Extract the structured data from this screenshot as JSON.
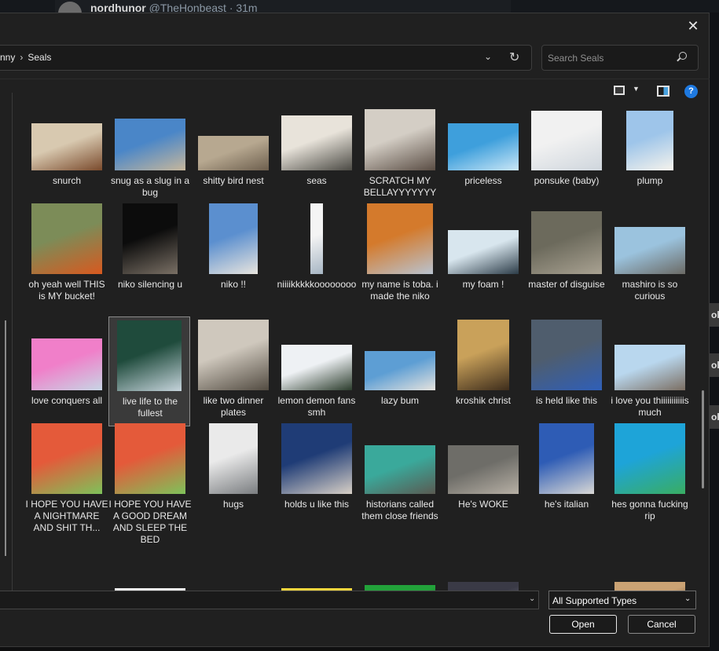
{
  "background": {
    "post_user": "nordhunor",
    "post_handle": "@TheHonbeast · 31m",
    "side_chips": [
      "ol",
      "ol",
      "ol"
    ]
  },
  "address": {
    "crumbs": [
      "nny",
      "Seals"
    ],
    "separator": "›"
  },
  "search": {
    "placeholder": "Search Seals"
  },
  "toolbar": {
    "view_icon": "thumbnail-view-icon",
    "preview_icon": "preview-pane-icon",
    "help_label": "?"
  },
  "files": [
    {
      "label": "snurch",
      "colors": [
        "#d8c9b0",
        "#7a4a2c"
      ]
    },
    {
      "label": "snug as a slug in a bug",
      "colors": [
        "#4a86c8",
        "#c7b79c"
      ]
    },
    {
      "label": "shitty bird nest",
      "colors": [
        "#b7a890",
        "#6d5f4e"
      ]
    },
    {
      "label": "seas",
      "colors": [
        "#e8e3da",
        "#4b4a44"
      ]
    },
    {
      "label": "SCRATCH MY BELLAYYYYYYY",
      "colors": [
        "#d4cec5",
        "#5a4d44"
      ]
    },
    {
      "label": "priceless",
      "colors": [
        "#3e9fdc",
        "#cbe7f6"
      ]
    },
    {
      "label": "ponsuke (baby)",
      "colors": [
        "#f1f1f1",
        "#cfd6dd"
      ]
    },
    {
      "label": "plump",
      "colors": [
        "#9ec5ea",
        "#f6f3ec"
      ]
    },
    {
      "label": "oh yeah well THIS is MY bucket!",
      "colors": [
        "#7c8c58",
        "#d8591f"
      ]
    },
    {
      "label": "niko silencing u",
      "colors": [
        "#0c0c0c",
        "#7a7065"
      ]
    },
    {
      "label": "niko !!",
      "colors": [
        "#5b8fcf",
        "#e9e5de"
      ]
    },
    {
      "label": "niiiikkkkkoooooooo",
      "colors": [
        "#f4f4f4",
        "#a7b6c4"
      ]
    },
    {
      "label": "my name is toba. i made the niko",
      "colors": [
        "#d47a2c",
        "#b9c3d0"
      ]
    },
    {
      "label": "my foam !",
      "colors": [
        "#d8e6ee",
        "#2c3c48"
      ]
    },
    {
      "label": "master of disguise",
      "colors": [
        "#6c6a5c",
        "#a9a292"
      ]
    },
    {
      "label": "mashiro is so curious",
      "colors": [
        "#9bc3de",
        "#6b6a65"
      ]
    },
    {
      "label": "love conquers all",
      "colors": [
        "#f07fc9",
        "#c7d6e5"
      ]
    },
    {
      "label": "live life to the fullest",
      "colors": [
        "#1f4b3c",
        "#c6d4dc"
      ]
    },
    {
      "label": "like two dinner plates",
      "colors": [
        "#cfc8bd",
        "#524b41"
      ]
    },
    {
      "label": "lemon demon fans smh",
      "colors": [
        "#eef1f4",
        "#2b3c2c"
      ]
    },
    {
      "label": "lazy bum",
      "colors": [
        "#5d9ed4",
        "#e6e3de"
      ]
    },
    {
      "label": "kroshik christ",
      "colors": [
        "#c9a15a",
        "#3e2d1c"
      ]
    },
    {
      "label": "is held like this",
      "colors": [
        "#4f5d6d",
        "#2f5fb8"
      ]
    },
    {
      "label": "i love you thiiiiiiiiiiis much",
      "colors": [
        "#b9d7ee",
        "#7b6e62"
      ]
    },
    {
      "label": "I HOPE YOU HAVE A NIGHTMARE AND SHIT TH...",
      "colors": [
        "#e45a3a",
        "#7ec25a"
      ]
    },
    {
      "label": "I HOPE YOU HAVE A GOOD DREAM AND SLEEP THE BED",
      "colors": [
        "#e45a3a",
        "#7ec25a"
      ]
    },
    {
      "label": "hugs",
      "colors": [
        "#eaeaea",
        "#7a7d80"
      ]
    },
    {
      "label": "holds u like this",
      "colors": [
        "#1f3c76",
        "#d8d0c6"
      ]
    },
    {
      "label": "historians called them close friends",
      "colors": [
        "#3aa99b",
        "#5a5a52"
      ]
    },
    {
      "label": "He's WOKE",
      "colors": [
        "#6e6d68",
        "#b7b0a5"
      ]
    },
    {
      "label": "he's italian",
      "colors": [
        "#2e5cb5",
        "#d9d8d5"
      ]
    },
    {
      "label": "hes gonna fucking rip",
      "colors": [
        "#1ea4d8",
        "#39ad62"
      ]
    },
    {
      "label": "",
      "colors": [
        "#e6e6e6",
        "#b0b0b0"
      ]
    },
    {
      "label": "",
      "colors": [
        "#f2f2f2",
        "#1c1c1c"
      ]
    },
    {
      "label": "",
      "colors": [
        "#c9ccd2",
        "#8f959c"
      ]
    },
    {
      "label": "",
      "colors": [
        "#f4d63d",
        "#d83c3c"
      ]
    },
    {
      "label": "",
      "colors": [
        "#22a23a",
        "#1b1b1b"
      ]
    },
    {
      "label": "",
      "colors": [
        "#3a3a46",
        "#8a8a94"
      ]
    },
    {
      "label": "",
      "colors": [
        "#9aa7b5",
        "#d6d6d6"
      ]
    },
    {
      "label": "",
      "colors": [
        "#caa274",
        "#2d2218"
      ]
    }
  ],
  "filename": {
    "value": ""
  },
  "filetype": {
    "value": "All Supported Types"
  },
  "buttons": {
    "open": "Open",
    "cancel": "Cancel"
  }
}
